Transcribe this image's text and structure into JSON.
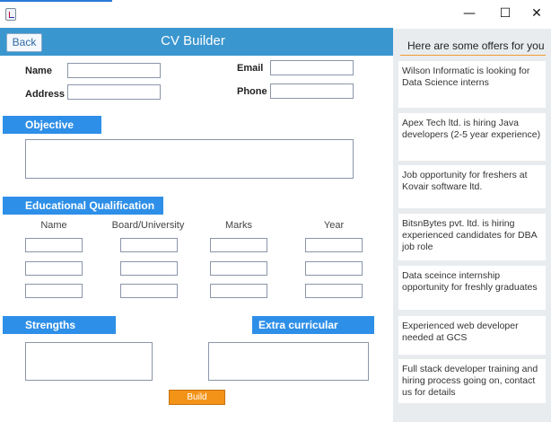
{
  "window": {
    "minimize_glyph": "—",
    "maximize_glyph": "☐",
    "close_glyph": "✕",
    "app_icon": "java-app-icon"
  },
  "header": {
    "back_label": "Back",
    "title": "CV Builder"
  },
  "personal": {
    "name_label": "Name",
    "address_label": "Address",
    "email_label": "Email",
    "phone_label": "Phone",
    "name_value": "",
    "address_value": "",
    "email_value": "",
    "phone_value": ""
  },
  "objective": {
    "label": "Objective",
    "value": ""
  },
  "education": {
    "label": "Educational Qualification",
    "columns": [
      "Name",
      "Board/University",
      "Marks",
      "Year"
    ],
    "rows": [
      [
        "",
        "",
        "",
        ""
      ],
      [
        "",
        "",
        "",
        ""
      ],
      [
        "",
        "",
        "",
        ""
      ]
    ]
  },
  "strengths": {
    "label": "Strengths",
    "value": ""
  },
  "extra": {
    "label": "Extra curricular",
    "value": ""
  },
  "build_label": "Build",
  "offers": {
    "header": "Here are some offers  for you",
    "items": [
      "Wilson Informatic is looking for Data Science interns",
      "Apex Tech ltd. is hiring Java developers (2-5 year experience)",
      "Job opportunity for freshers at Kovair software ltd.",
      "BitsnBytes pvt. ltd. is hiring experienced candidates for DBA job role",
      "Data sceince internship opportunity for freshly graduates",
      "Experienced web developer needed at GCS",
      "Full stack developer training and hiring process going on, contact us for details"
    ]
  },
  "colors": {
    "header": "#3a96cf",
    "section": "#2e8fe8",
    "build": "#f39418",
    "offers_bg": "#e9ecef",
    "offers_rule": "#f29a2e"
  }
}
